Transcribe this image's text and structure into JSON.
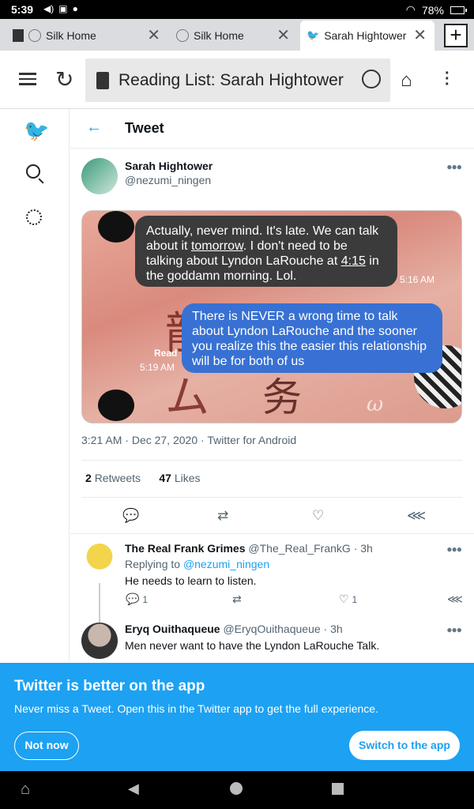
{
  "status": {
    "time": "5:39",
    "battery": "78%"
  },
  "tabs": [
    {
      "label": "Silk Home"
    },
    {
      "label": "Silk Home"
    },
    {
      "label": "Sarah Hightower"
    }
  ],
  "toolbar": {
    "url_title": "Reading List: Sarah Hightower"
  },
  "page": {
    "header_title": "Tweet"
  },
  "tweet": {
    "author_name": "Sarah Hightower",
    "author_handle": "@nezumi_ningen",
    "bubble_left_pre": "Actually, never mind. It's late. We can talk about it ",
    "bubble_left_link1": "tomorrow",
    "bubble_left_mid": ". I don't need to be talking about Lyndon LaRouche at ",
    "bubble_left_link2": "4:15",
    "bubble_left_post": " in the goddamn morning. Lol.",
    "bubble_left_time": "5:16 AM",
    "bubble_right": "There is NEVER a wrong time to talk about Lyndon LaRouche and the sooner you realize this the easier this relationship will be for both of us",
    "read_label": "Read",
    "bubble_right_time": "5:19 AM",
    "time": "3:21 AM",
    "date": "Dec 27, 2020",
    "source": "Twitter for Android",
    "retweets_count": "2",
    "retweets_label": "Retweets",
    "likes_count": "47",
    "likes_label": "Likes"
  },
  "replies": [
    {
      "name": "The Real Frank Grimes",
      "handle": "@The_Real_FrankG",
      "age": "3h",
      "replying_label": "Replying to",
      "replying_to": "@nezumi_ningen",
      "text": "He needs to learn to listen.",
      "reply_count": "1",
      "like_count": "1"
    },
    {
      "name": "Eryq Ouithaqueue",
      "handle": "@EryqOuithaqueue",
      "age": "3h",
      "text": "Men never want to have the Lyndon LaRouche Talk."
    }
  ],
  "banner": {
    "title": "Twitter is better on the app",
    "subtitle": "Never miss a Tweet. Open this in the Twitter app to get the full experience.",
    "not_now": "Not now",
    "switch": "Switch to the app"
  },
  "icons": {
    "back": "arrow-left-icon",
    "twitter": "twitter-bird-icon",
    "search": "search-icon",
    "settings": "gear-icon"
  },
  "colors": {
    "accent": "#1da1f2",
    "bubble_blue": "#3871d3",
    "bubble_gray": "#3b3b3b"
  }
}
